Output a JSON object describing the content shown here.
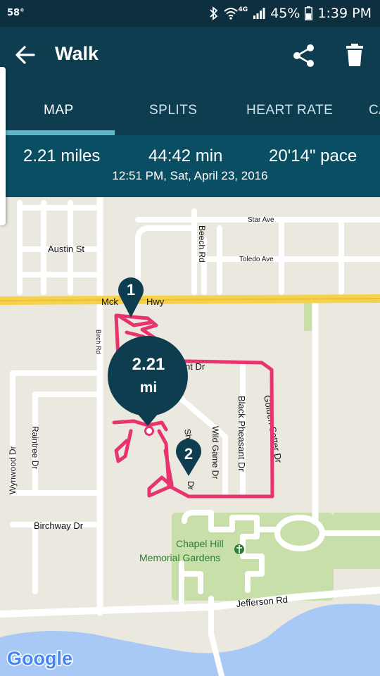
{
  "status_bar": {
    "temperature": "58°",
    "network": "4G",
    "battery": "45%",
    "time": "1:39 PM"
  },
  "app_bar": {
    "title": "Walk",
    "back_icon": "arrow-left-icon",
    "share_icon": "share-icon",
    "delete_icon": "trash-icon"
  },
  "tabs": [
    {
      "label": "MAP",
      "active": true
    },
    {
      "label": "SPLITS",
      "active": false
    },
    {
      "label": "HEART RATE",
      "active": false
    },
    {
      "label": "CA",
      "active": false
    }
  ],
  "summary": {
    "distance": "2.21 miles",
    "duration": "44:42 min",
    "pace": "20'14\" pace",
    "datetime": "12:51 PM, Sat, April 23, 2016"
  },
  "map": {
    "streets": {
      "star_ave": "Star Ave",
      "beech_rd": "Beech Rd",
      "austin_st": "Austin St",
      "toledo_ave": "Toledo Ave",
      "highway_left": "Mck",
      "highway_right": "Hwy",
      "birch_rd": "Birch Rd",
      "pheasant_fragment": "nt Dr",
      "golden_setter": "Golden Setter Dr",
      "black_pheasant": "Black Pheasant Dr",
      "wild_game": "Wild Game Dr",
      "sh_fragment_1": "Sh",
      "sh_fragment_2": "Dr",
      "raintree": "Raintree Dr",
      "wynwood": "Wynwood Dr",
      "birchway": "Birchway Dr",
      "jefferson": "Jefferson Rd",
      "chapel_hill_line1": "Chapel Hill",
      "chapel_hill_line2": "Memorial Gardens"
    },
    "markers": {
      "start_label": "1",
      "end_label": "2",
      "total_value": "2.21",
      "total_unit": "mi"
    },
    "attribution": "Google",
    "route_color": "#e8336f",
    "marker_color": "#0d3d4f"
  }
}
